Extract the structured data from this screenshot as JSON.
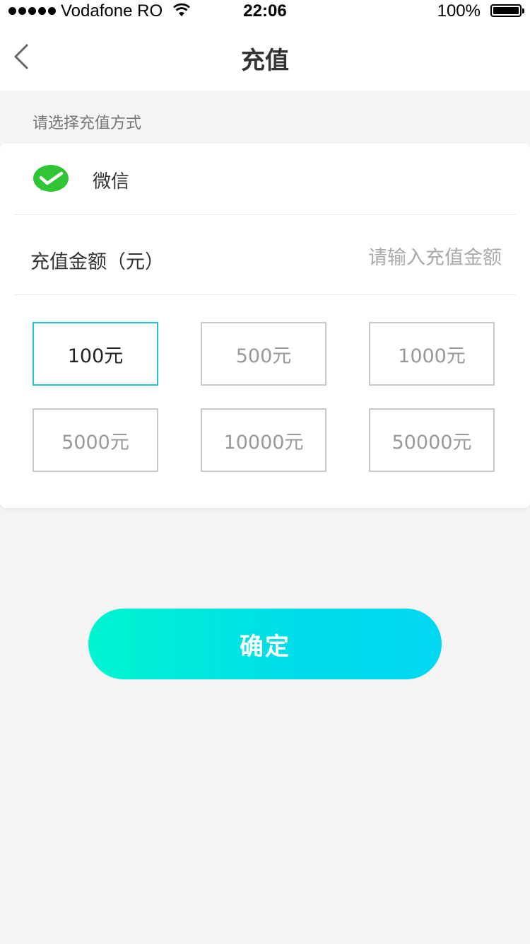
{
  "status_bar": {
    "carrier": "Vodafone RO",
    "time": "22:06",
    "battery": "100%"
  },
  "nav": {
    "title": "充值",
    "back_icon": "chevron-left-icon"
  },
  "section_label": "请选择充值方式",
  "payment": {
    "method": "微信",
    "icon": "wechat-pay-icon",
    "icon_color": "#2fc535"
  },
  "amount": {
    "label": "充值金额（元）",
    "placeholder": "请输入充值金额"
  },
  "options": [
    {
      "label": "100元",
      "selected": true
    },
    {
      "label": "500元",
      "selected": false
    },
    {
      "label": "1000元",
      "selected": false
    },
    {
      "label": "5000元",
      "selected": false
    },
    {
      "label": "10000元",
      "selected": false
    },
    {
      "label": "50000元",
      "selected": false
    }
  ],
  "confirm_label": "确定",
  "colors": {
    "accent_start": "#00f5d0",
    "accent_end": "#00d8f2",
    "selected_border": "#22c1d6",
    "background": "#f4f4f5"
  }
}
